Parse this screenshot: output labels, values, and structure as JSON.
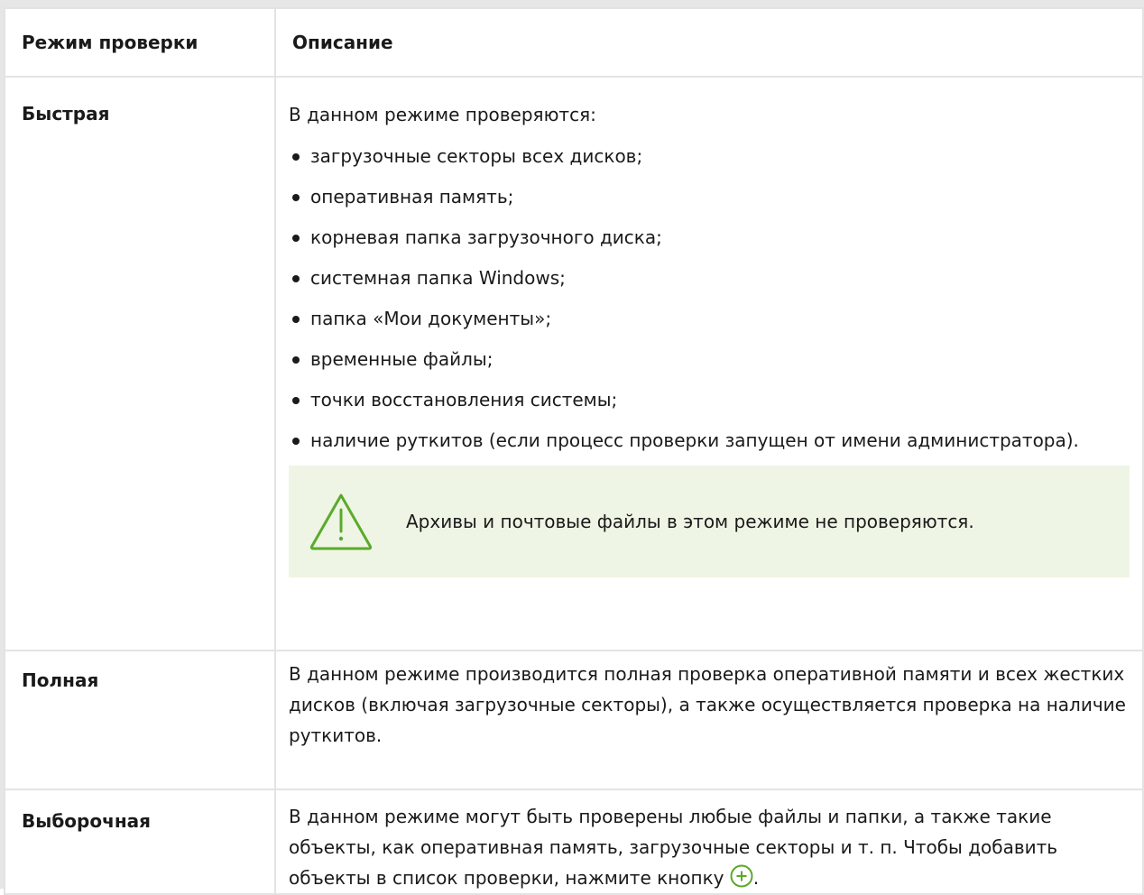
{
  "table": {
    "headers": [
      "Режим проверки",
      "Описание"
    ],
    "rows": [
      {
        "mode": "Быстрая",
        "intro": "В данном режиме проверяются:",
        "items": [
          "загрузочные секторы всех дисков;",
          "оперативная память;",
          "корневая папка загрузочного диска;",
          "системная папка Windows;",
          "папка «Мои документы»;",
          "временные файлы;",
          "точки восстановления системы;",
          "наличие руткитов (если процесс проверки запущен от имени администратора)."
        ],
        "note": "Архивы и почтовые файлы в этом режиме не проверяются."
      },
      {
        "mode": "Полная",
        "text": "В данном режиме производится полная проверка оперативной памяти и всех жестких дисков (включая загрузочные секторы), а также осуществляется проверка на наличие руткитов."
      },
      {
        "mode": "Выборочная",
        "text": "В данном режиме могут быть проверены любые файлы и папки, а также такие объекты, как оперативная память, загрузочные секторы и т. п. Чтобы добавить объекты в список проверки, нажмите кнопку",
        "text_end": "."
      }
    ]
  },
  "colors": {
    "accent": "#5aaa2a",
    "note_bg": "#eef5e4",
    "border": "#e3e3e3"
  },
  "icons": {
    "note_icon": "warning-triangle-icon",
    "add_icon": "plus-circle-icon"
  }
}
